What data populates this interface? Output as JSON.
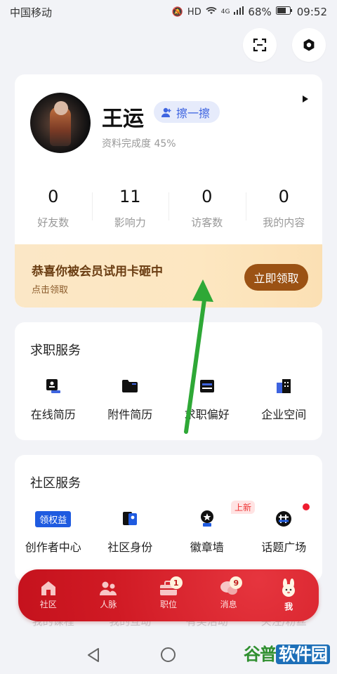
{
  "status_bar": {
    "carrier": "中国移动",
    "battery": "68%",
    "time": "09:52",
    "network": "4G"
  },
  "profile": {
    "name": "王运",
    "rub_label": "擦一擦",
    "completion": "资料完成度 45%",
    "stats": [
      {
        "value": "0",
        "label": "好友数"
      },
      {
        "value": "11",
        "label": "影响力"
      },
      {
        "value": "0",
        "label": "访客数"
      },
      {
        "value": "0",
        "label": "我的内容"
      }
    ]
  },
  "banner": {
    "title": "恭喜你被会员试用卡砸中",
    "subtitle": "点击领取",
    "button": "立即领取"
  },
  "job_services": {
    "title": "求职服务",
    "items": [
      {
        "label": "在线简历",
        "icon": "resume-icon"
      },
      {
        "label": "附件简历",
        "icon": "folder-icon"
      },
      {
        "label": "求职偏好",
        "icon": "preference-icon"
      },
      {
        "label": "企业空间",
        "icon": "building-icon"
      }
    ]
  },
  "community_services": {
    "title": "社区服务",
    "items": [
      {
        "label": "创作者中心",
        "icon": "creator-rights-icon",
        "tag": "领权益"
      },
      {
        "label": "社区身份",
        "icon": "identity-icon"
      },
      {
        "label": "徽章墙",
        "icon": "badge-icon",
        "badge": "上新"
      },
      {
        "label": "话题广场",
        "icon": "topic-icon"
      }
    ]
  },
  "hidden_row": [
    "我的课程",
    "我的互动",
    "有奖活动",
    "关注/粉丝"
  ],
  "tabbar": [
    {
      "label": "社区",
      "icon": "home-icon"
    },
    {
      "label": "人脉",
      "icon": "contacts-icon"
    },
    {
      "label": "职位",
      "icon": "briefcase-icon",
      "badge": "1"
    },
    {
      "label": "消息",
      "icon": "message-icon",
      "badge": "9"
    },
    {
      "label": "我",
      "icon": "bunny-icon"
    }
  ],
  "watermark": {
    "part1": "谷普",
    "part2": "软件园"
  },
  "colors": {
    "accent_blue": "#3e64e0",
    "brand_red": "#d01a24",
    "banner_button": "#9b5214",
    "annotation_arrow": "#2ea836"
  }
}
